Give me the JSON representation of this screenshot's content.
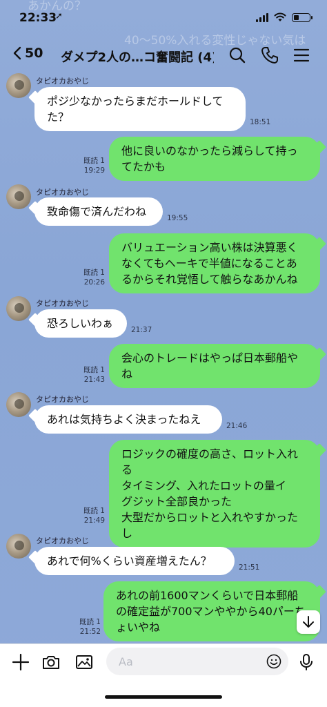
{
  "status": {
    "time": "22:33",
    "location_glyph": "➚",
    "battery_level": 0.35
  },
  "ghost": {
    "line1": "あかんの？",
    "line2": "40〜50%入れる変性じゃない気は"
  },
  "header": {
    "back_count": "50",
    "title": "ダメプ2人の…コ奮闘記 (4)"
  },
  "colors": {
    "background": "#8aa7d6",
    "incoming_bubble": "#ffffff",
    "outgoing_bubble": "#71e36d"
  },
  "messages": [
    {
      "dir": "in",
      "sender": "タピオカおやじ",
      "text": "ポジ少なかったらまだホールドして\nた？",
      "time": "18:51"
    },
    {
      "dir": "out",
      "read": "既読 1",
      "text": "他に良いのなかったら減らして持っ\nてたかも",
      "time": "19:29"
    },
    {
      "dir": "in",
      "sender": "タピオカおやじ",
      "text": "致命傷で済んだわね",
      "time": "19:55"
    },
    {
      "dir": "out",
      "read": "既読 1",
      "text": "バリュエーション高い株は決算悪く\nなくてもヘーキで半値になることあ\nるからそれ覚悟して触らなあかんね",
      "time": "20:26"
    },
    {
      "dir": "in",
      "sender": "タピオカおやじ",
      "text": "恐ろしいわぁ",
      "time": "21:37"
    },
    {
      "dir": "out",
      "read": "既読 1",
      "text": "会心のトレードはやっぱ日本郵船や\nね",
      "time": "21:43"
    },
    {
      "dir": "in",
      "sender": "タピオカおやじ",
      "text": "あれは気持ちよく決まったねえ",
      "time": "21:46"
    },
    {
      "dir": "out",
      "read": "既読 1",
      "text": "ロジックの確度の高さ、ロット入れる\nタイミング、入れたロットの量イ\nグジット全部良かった\n大型だからロットと入れやすかった\nし",
      "time": "21:49"
    },
    {
      "dir": "in",
      "sender": "タピオカおやじ",
      "text": "あれで何%くらい資産増えたん？",
      "time": "21:51"
    },
    {
      "dir": "out",
      "read": "既読 1",
      "text": "あれの前1600マンくらいで日本郵船\nの確定益が700マンややから40パーち\nょいやね",
      "time": "21:52"
    }
  ],
  "input": {
    "placeholder": "Aa"
  }
}
